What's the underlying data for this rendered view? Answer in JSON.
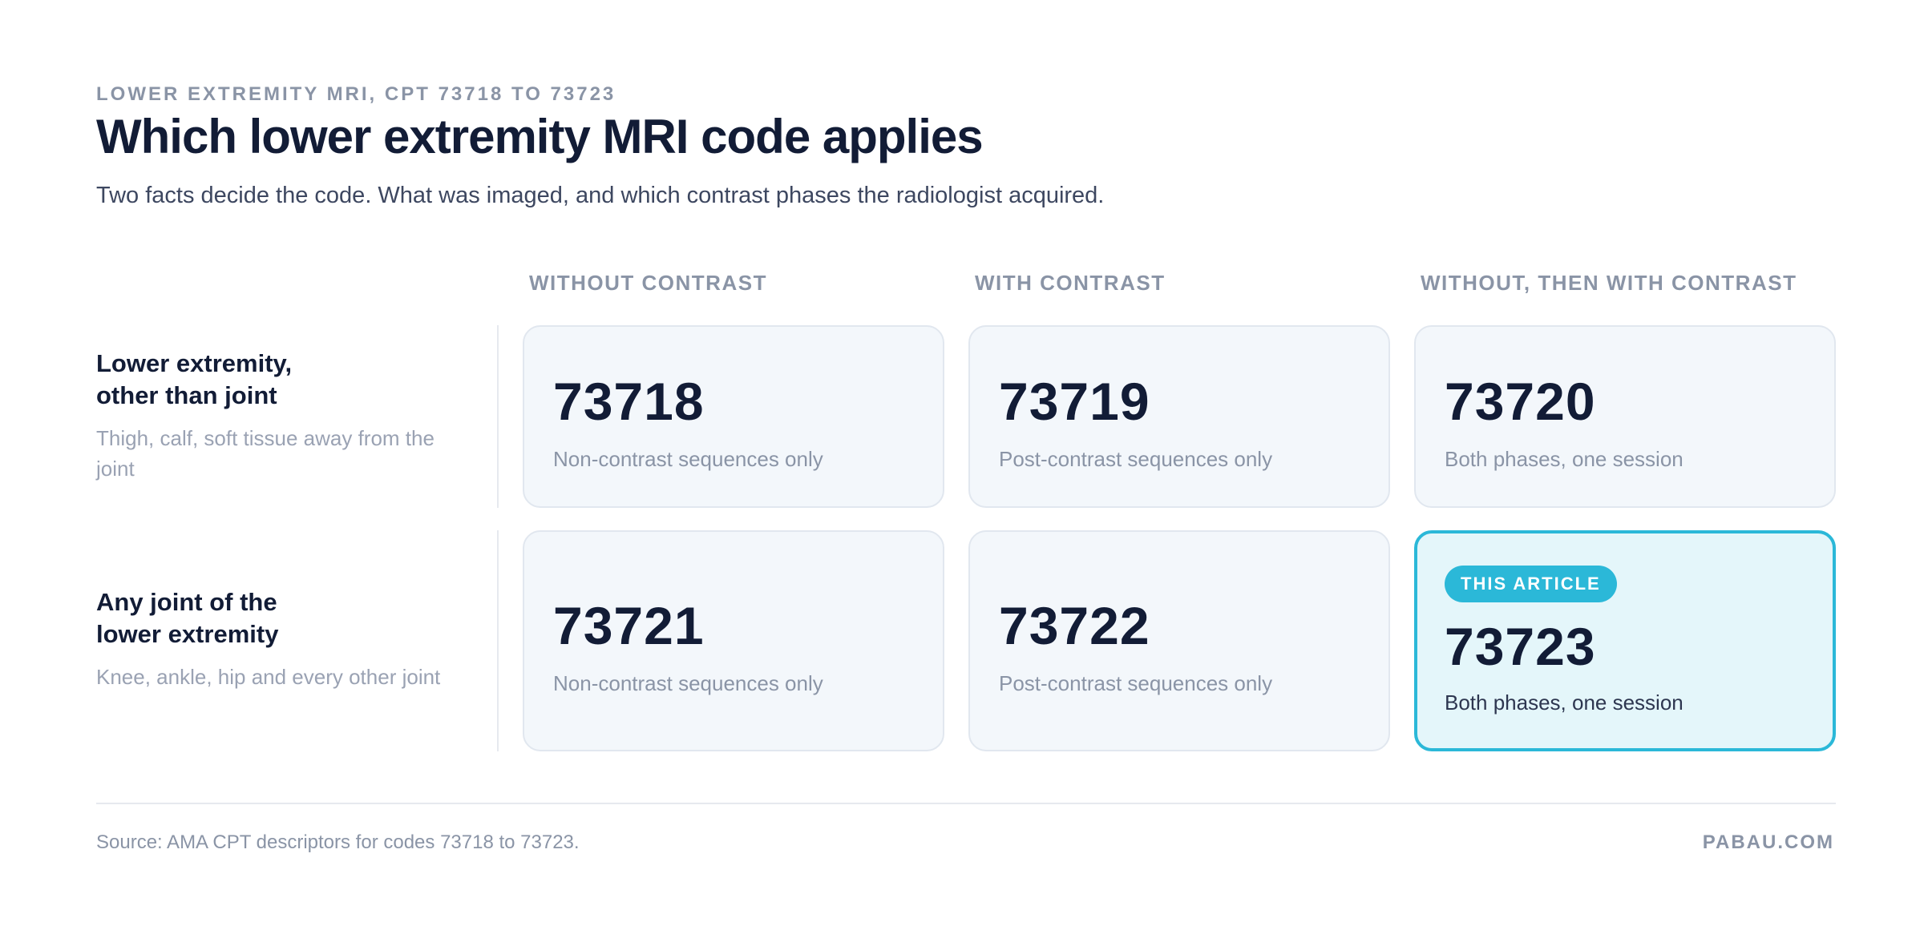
{
  "header": {
    "eyebrow": "LOWER EXTREMITY MRI, CPT 73718 TO 73723",
    "title": "Which lower extremity MRI code applies",
    "subtitle": "Two facts decide the code. What was imaged, and which contrast phases the radiologist acquired."
  },
  "columns": [
    "WITHOUT CONTRAST",
    "WITH CONTRAST",
    "WITHOUT, THEN WITH CONTRAST"
  ],
  "rows": [
    {
      "title_line1": "Lower extremity,",
      "title_line2": "other than joint",
      "description": "Thigh, calf, soft tissue away from the joint",
      "cells": [
        {
          "code": "73718",
          "description": "Non-contrast sequences only"
        },
        {
          "code": "73719",
          "description": "Post-contrast sequences only"
        },
        {
          "code": "73720",
          "description": "Both phases, one session"
        }
      ]
    },
    {
      "title_line1": "Any joint of the",
      "title_line2": "lower extremity",
      "description": "Knee, ankle, hip and every other joint",
      "cells": [
        {
          "code": "73721",
          "description": "Non-contrast sequences only"
        },
        {
          "code": "73722",
          "description": "Post-contrast sequences only"
        },
        {
          "code": "73723",
          "description": "Both phases, one session",
          "badge": "THIS ARTICLE"
        }
      ]
    }
  ],
  "footer": {
    "source": "Source: AMA CPT descriptors for codes 73718 to 73723.",
    "brand": "PABAU.COM"
  },
  "colors": {
    "highlight": "#2bb8d8",
    "highlight_bg": "#e4f6fa",
    "card_bg": "#f3f7fb",
    "text_dark": "#121c36",
    "text_muted": "#8a94a6"
  }
}
